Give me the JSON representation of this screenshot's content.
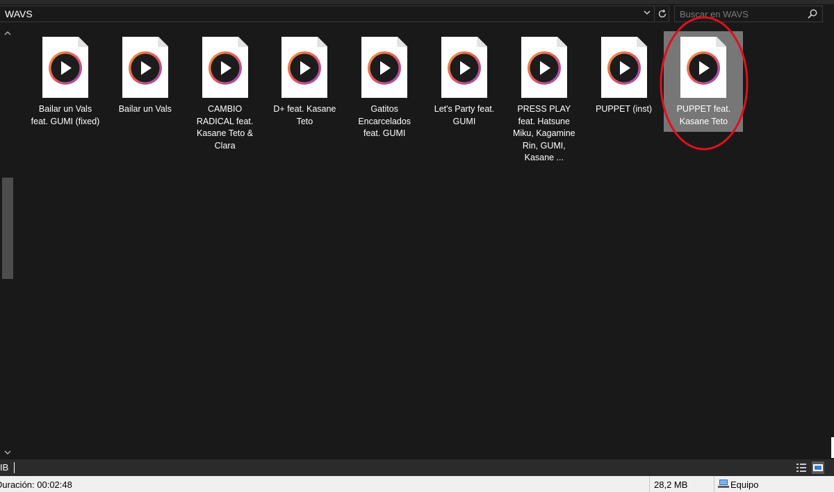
{
  "address_bar": {
    "path": "WAVS",
    "history_icon": "chevron-down-icon",
    "refresh_icon": "refresh-icon"
  },
  "search": {
    "placeholder": "Buscar en WAVS",
    "icon": "search-icon"
  },
  "files": [
    {
      "name": "Bailar un Vals feat. GUMI (fixed)",
      "selected": false
    },
    {
      "name": "Bailar un Vals",
      "selected": false
    },
    {
      "name": "CAMBIO RADICAL feat. Kasane Teto & Clara",
      "selected": false
    },
    {
      "name": "D+ feat. Kasane Teto",
      "selected": false
    },
    {
      "name": "Gatitos Encarcelados feat. GUMI",
      "selected": false
    },
    {
      "name": "Let's Party feat. GUMI",
      "selected": false
    },
    {
      "name": "PRESS PLAY feat. Hatsune Miku, Kagamine Rin, GUMI, Kasane ...",
      "selected": false
    },
    {
      "name": "PUPPET (inst)",
      "selected": false
    },
    {
      "name": "PUPPET feat. Kasane Teto",
      "selected": true
    }
  ],
  "view_bar": {
    "left_text": "IB"
  },
  "status_bar": {
    "duration": "Duración: 00:02:48",
    "size": "28,2 MB",
    "zone": "Equipo"
  },
  "colors": {
    "background": "#191919",
    "selection": "#777777",
    "annotation_circle": "#e0101a",
    "status_bar": "#f0f0f0"
  }
}
